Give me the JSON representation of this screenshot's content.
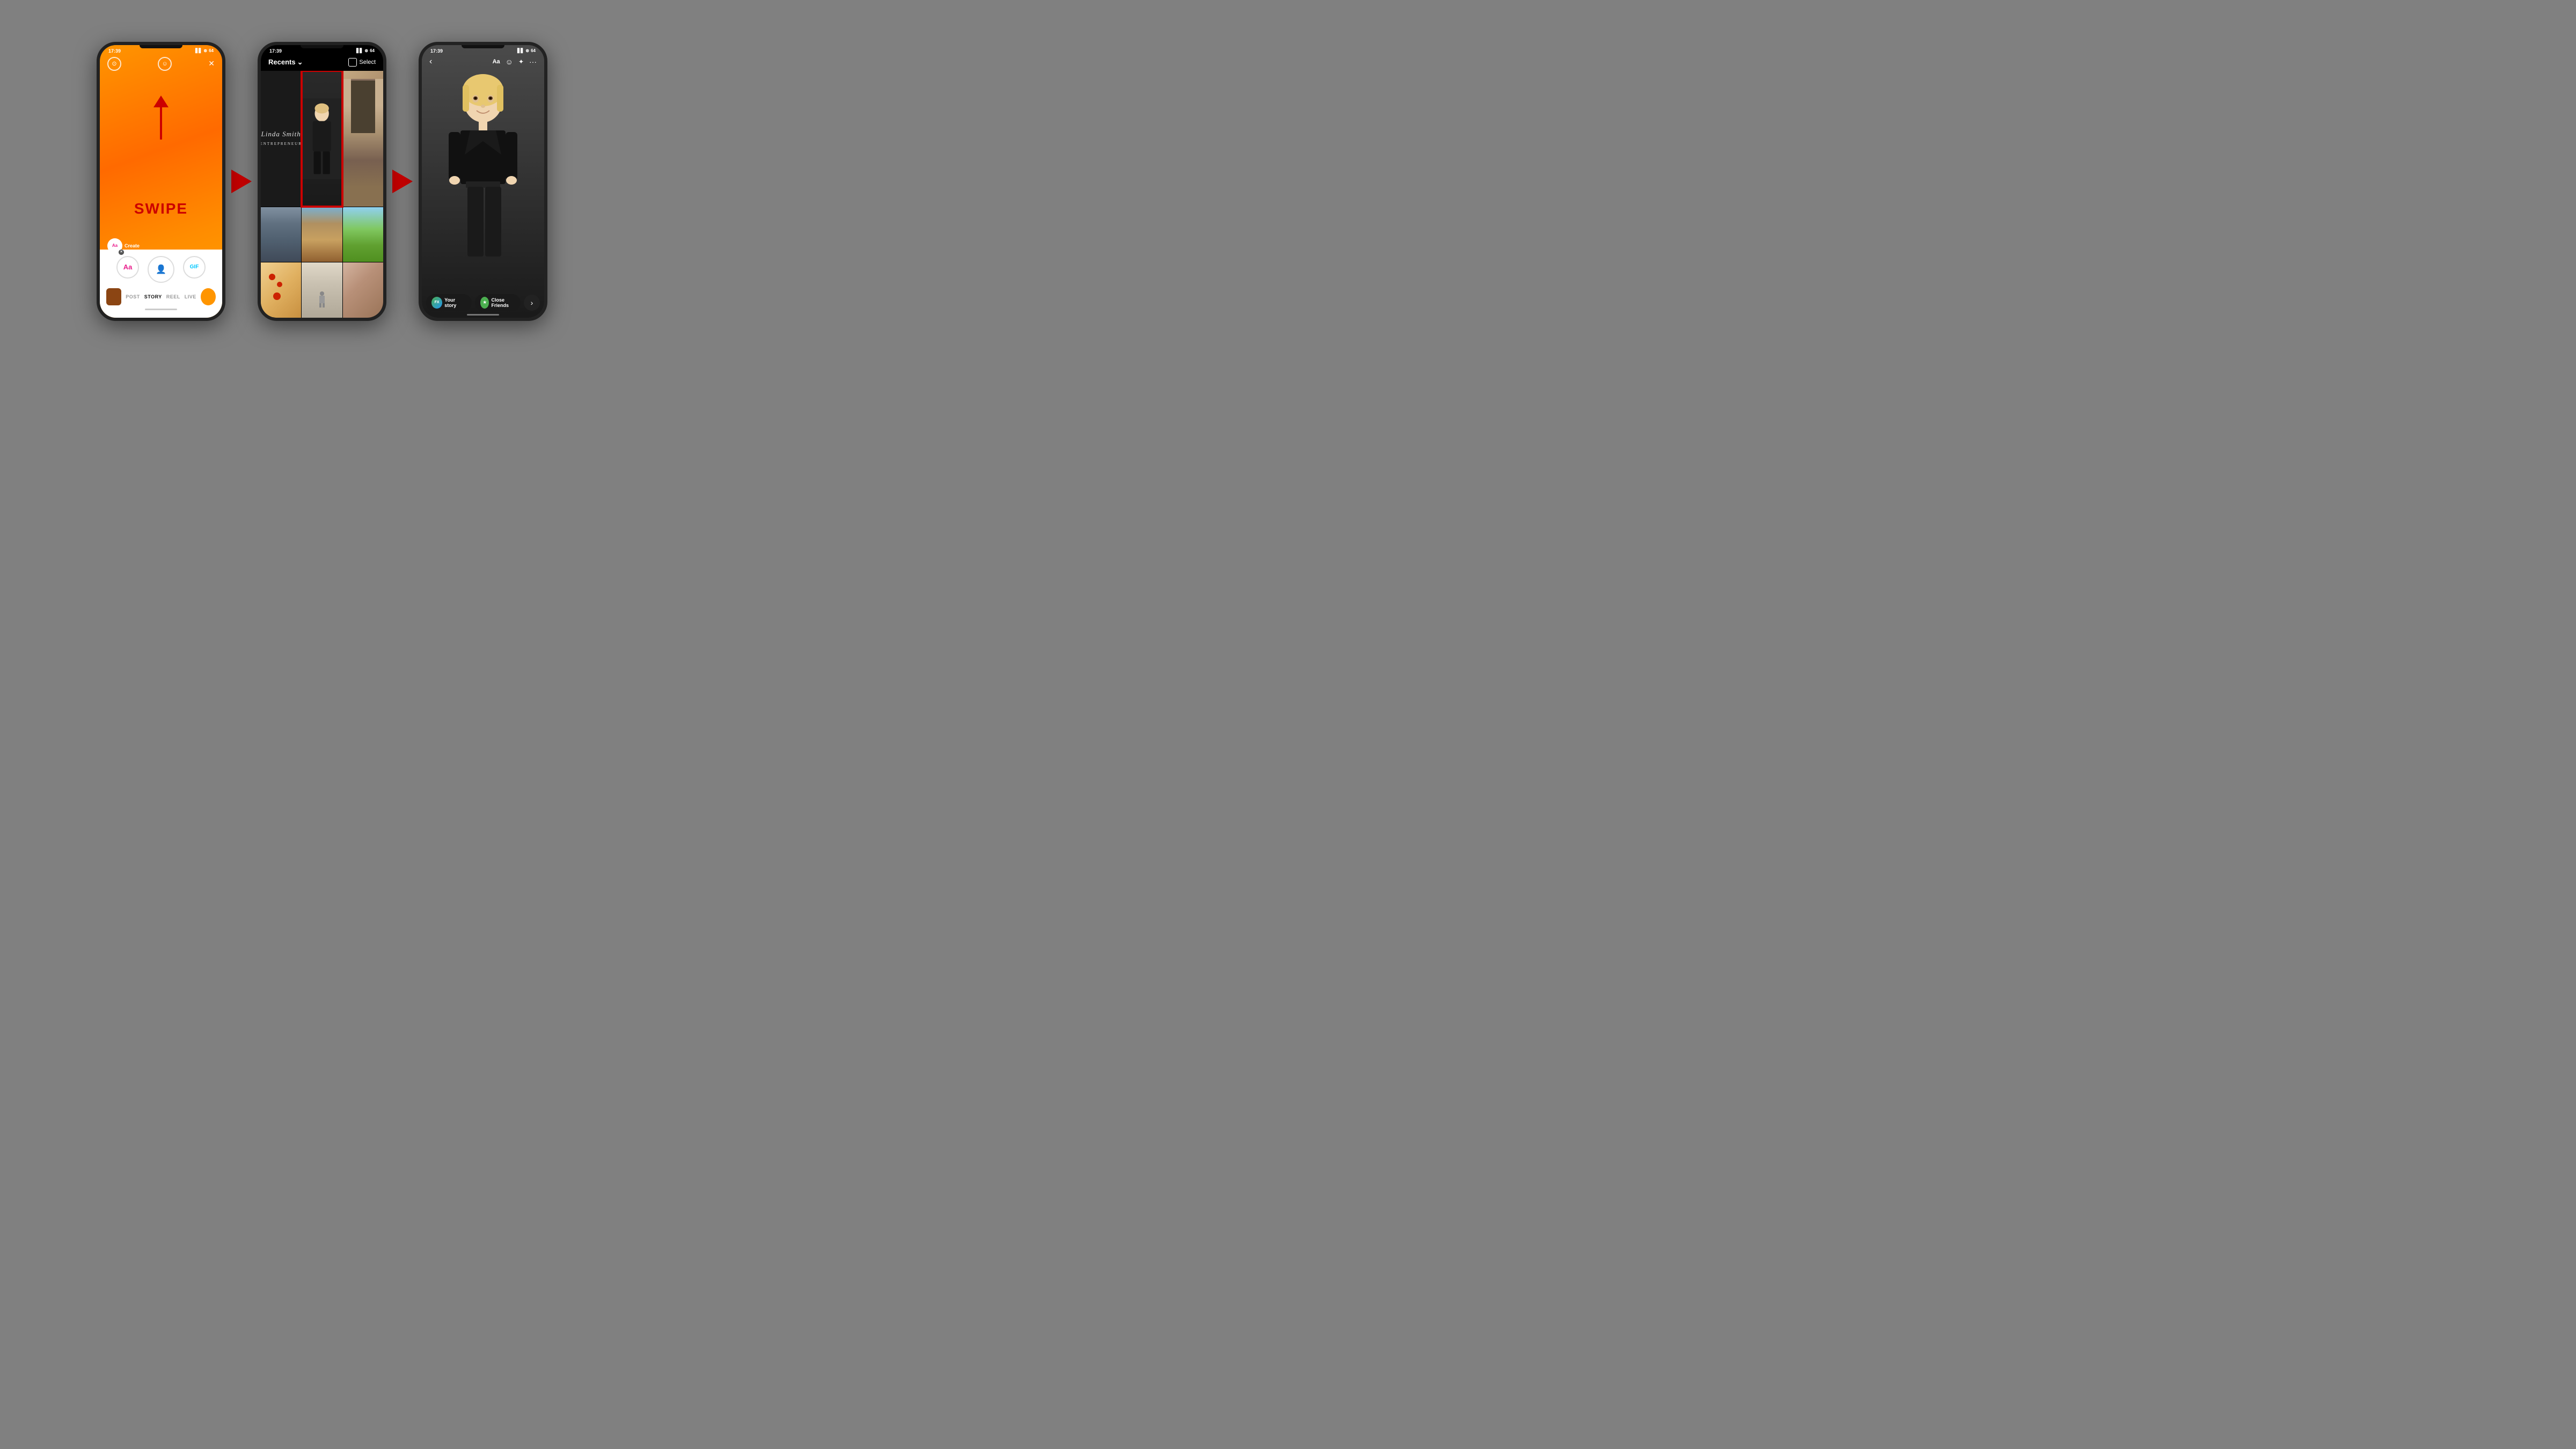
{
  "page": {
    "background": "#808080"
  },
  "phone1": {
    "status_time": "17:39",
    "status_icons": "▋▋ ⊛ 64",
    "top_icons": [
      "⊙",
      "☺",
      "×"
    ],
    "swipe_text": "SWIPE",
    "create_label": "Create",
    "nav_tabs": [
      "POST",
      "STORY",
      "REEL",
      "LIVE"
    ],
    "active_tab": "STORY",
    "action_buttons": [
      "Aa",
      "👤",
      "GIF"
    ]
  },
  "phone2": {
    "status_time": "17:39",
    "recents_label": "Recents",
    "select_label": "Select",
    "photos": [
      {
        "id": "logo",
        "type": "logo",
        "text": "Linda Smith"
      },
      {
        "id": "person",
        "type": "person",
        "selected": true
      },
      {
        "id": "restaurant",
        "type": "restaurant"
      },
      {
        "id": "street",
        "type": "street"
      },
      {
        "id": "alley",
        "type": "alley"
      },
      {
        "id": "field",
        "type": "field"
      },
      {
        "id": "food",
        "type": "food"
      },
      {
        "id": "interior",
        "type": "interior"
      },
      {
        "id": "floral",
        "type": "floral"
      }
    ]
  },
  "phone3": {
    "status_time": "17:39",
    "top_icons": [
      "←",
      "Aa",
      "☺",
      "✦",
      "···"
    ],
    "your_story_label": "Your story",
    "close_friends_label": "Close Friends",
    "send_icon": "→"
  },
  "arrows": {
    "label": "red play arrow"
  }
}
